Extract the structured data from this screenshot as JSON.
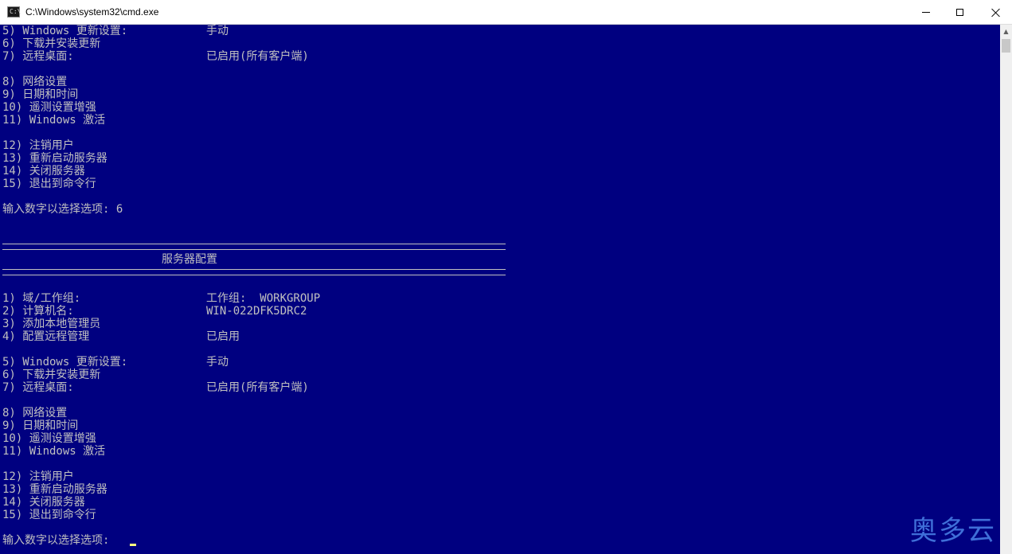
{
  "window": {
    "title": "C:\\Windows\\system32\\cmd.exe",
    "icon_text": "C:\\"
  },
  "console": {
    "top_block": {
      "item5": "5) Windows 更新设置:",
      "item5_value": "手动",
      "item6": "6) 下载并安装更新",
      "item7": "7) 远程桌面:",
      "item7_value": "已启用(所有客户端)",
      "item8": "8) 网络设置",
      "item9": "9) 日期和时间",
      "item10": "10) 遥测设置增强",
      "item11": "11) Windows 激活",
      "item12": "12) 注销用户",
      "item13": "13) 重新启动服务器",
      "item14": "14) 关闭服务器",
      "item15": "15) 退出到命令行",
      "prompt": "输入数字以选择选项: 6"
    },
    "header": {
      "title": "服务器配置"
    },
    "menu": {
      "item1": "1) 域/工作组:",
      "item1_value": "工作组:  WORKGROUP",
      "item2": "2) 计算机名:",
      "item2_value": "WIN-022DFK5DRC2",
      "item3": "3) 添加本地管理员",
      "item4": "4) 配置远程管理",
      "item4_value": "已启用",
      "item5": "5) Windows 更新设置:",
      "item5_value": "手动",
      "item6": "6) 下载并安装更新",
      "item7": "7) 远程桌面:",
      "item7_value": "已启用(所有客户端)",
      "item8": "8) 网络设置",
      "item9": "9) 日期和时间",
      "item10": "10) 遥测设置增强",
      "item11": "11) Windows 激活",
      "item12": "12) 注销用户",
      "item13": "13) 重新启动服务器",
      "item14": "14) 关闭服务器",
      "item15": "15) 退出到命令行",
      "prompt": "输入数字以选择选项:"
    }
  },
  "watermark": {
    "text": "奥多云"
  },
  "colors": {
    "console_background": "#000080",
    "console_text": "#c0c0c0",
    "cursor": "#ffff80",
    "watermark": "#3f6fd8"
  }
}
